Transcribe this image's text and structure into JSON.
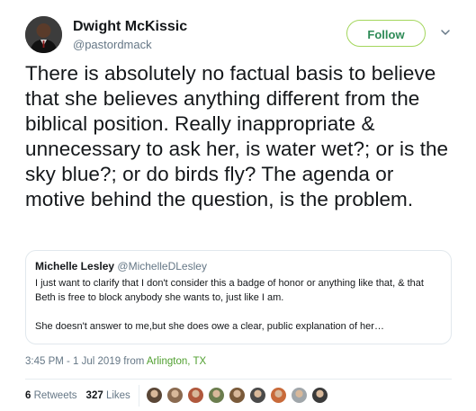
{
  "author": {
    "name": "Dwight McKissic",
    "handle": "@pastordmack"
  },
  "follow_label": "Follow",
  "tweet_text": "There is absolutely no factual basis to believe that she believes anything different from the biblical position. Really inappropriate & unnecessary to ask her, is water wet?; or is the sky blue?; or do birds fly? The agenda or motive behind the question, is the problem.",
  "quoted": {
    "name": "Michelle Lesley",
    "handle": "@MichelleDLesley",
    "paragraph1": "I just want to clarify that I don't consider this a badge of honor or anything like that, & that Beth is free to block anybody she wants to, just like I am.",
    "paragraph2": "She doesn't answer to me,but she does owe a clear, public explanation of her…"
  },
  "meta": {
    "time": "3:45 PM - 1 Jul 2019 from ",
    "location": "Arlington, TX"
  },
  "stats": {
    "retweets_count": "6",
    "retweets_label": "Retweets",
    "likes_count": "327",
    "likes_label": "Likes"
  },
  "colors": {
    "follow_border": "#a3d65c",
    "follow_text": "#2e8b57",
    "location": "#4f9f2e"
  },
  "liker_avatars": [
    {
      "icon": "avatar-photo",
      "color": "#5a4636"
    },
    {
      "icon": "avatar-photo",
      "color": "#8a6a50"
    },
    {
      "icon": "avatar-photo",
      "color": "#b0583c"
    },
    {
      "icon": "avatar-photo",
      "color": "#6b7d4e"
    },
    {
      "icon": "avatar-photo",
      "color": "#7a5a3a"
    },
    {
      "icon": "avatar-photo",
      "color": "#4a4a4a"
    },
    {
      "icon": "avatar-photo",
      "color": "#c86a3a"
    },
    {
      "icon": "avatar-photo",
      "color": "#a0a6aa"
    },
    {
      "icon": "avatar-photo",
      "color": "#3a3a3a"
    }
  ]
}
